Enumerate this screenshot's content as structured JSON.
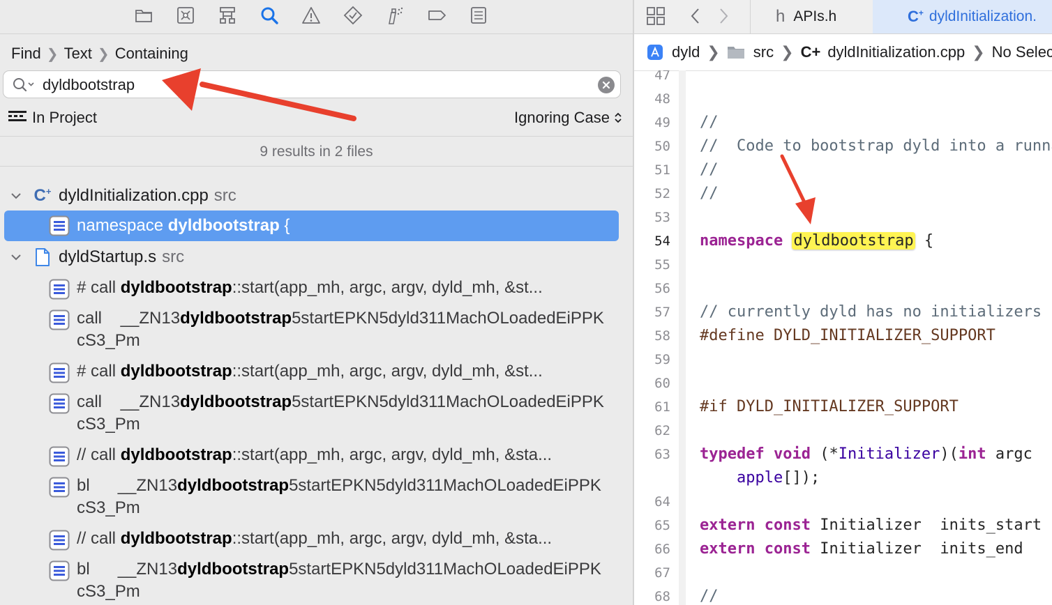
{
  "navigator": {
    "toolbar_icons": [
      "folder-icon",
      "source-control-icon",
      "hierarchy-icon",
      "find-icon",
      "issue-icon",
      "test-icon",
      "debug-icon",
      "breakpoint-icon",
      "report-icon"
    ],
    "breadcrumb": [
      "Find",
      "Text",
      "Containing"
    ],
    "search": {
      "value": "dyldbootstrap"
    },
    "scope": "In Project",
    "case_mode": "Ignoring Case",
    "summary": "9 results in 2 files",
    "files": [
      {
        "name": "dyldInitialization.cpp",
        "dir": "src",
        "results": [
          {
            "pre": "namespace ",
            "match": "dyldbootstrap",
            "post": " {",
            "selected": true
          }
        ]
      },
      {
        "name": "dyldStartup.s",
        "dir": "src",
        "results": [
          {
            "pre": "# call ",
            "match": "dyldbootstrap",
            "post": "::start(app_mh, argc, argv, dyld_mh, &st..."
          },
          {
            "pre": "call    __ZN13",
            "match": "dyldbootstrap",
            "post": "5startEPKN5dyld311MachOLoadedEiPPKcS3_Pm"
          },
          {
            "pre": "# call ",
            "match": "dyldbootstrap",
            "post": "::start(app_mh, argc, argv, dyld_mh, &st..."
          },
          {
            "pre": "call    __ZN13",
            "match": "dyldbootstrap",
            "post": "5startEPKN5dyld311MachOLoadedEiPPKcS3_Pm"
          },
          {
            "pre": "// call ",
            "match": "dyldbootstrap",
            "post": "::start(app_mh, argc, argv, dyld_mh, &sta..."
          },
          {
            "pre": "bl      __ZN13",
            "match": "dyldbootstrap",
            "post": "5startEPKN5dyld311MachOLoadedEiPPKcS3_Pm"
          },
          {
            "pre": "// call ",
            "match": "dyldbootstrap",
            "post": "::start(app_mh, argc, argv, dyld_mh, &sta..."
          },
          {
            "pre": "bl      __ZN13",
            "match": "dyldbootstrap",
            "post": "5startEPKN5dyld311MachOLoadedEiPPKcS3_Pm"
          }
        ]
      }
    ]
  },
  "editor": {
    "tabs": [
      {
        "icon": "h",
        "label": "APIs.h",
        "active": false
      },
      {
        "icon": "C+",
        "label": "dyldInitialization.",
        "active": true
      }
    ],
    "jump_bar": {
      "project": "dyld",
      "folder": "src",
      "file_icon": "C+",
      "file": "dyldInitialization.cpp",
      "selection": "No Selec"
    },
    "current_line": "54",
    "lines": [
      {
        "n": "47",
        "tokens": []
      },
      {
        "n": "48",
        "tokens": []
      },
      {
        "n": "49",
        "tokens": [
          {
            "t": "//",
            "c": "comment"
          }
        ]
      },
      {
        "n": "50",
        "tokens": [
          {
            "t": "//  Code to bootstrap dyld into a runnable state",
            "c": "comment"
          }
        ]
      },
      {
        "n": "51",
        "tokens": [
          {
            "t": "//",
            "c": "comment"
          }
        ]
      },
      {
        "n": "52",
        "tokens": [
          {
            "t": "//",
            "c": "comment"
          }
        ]
      },
      {
        "n": "53",
        "tokens": []
      },
      {
        "n": "54",
        "tokens": [
          {
            "t": "namespace",
            "c": "kw"
          },
          {
            "t": " "
          },
          {
            "t": "dyldbootstrap",
            "c": "hl"
          },
          {
            "t": " {"
          }
        ]
      },
      {
        "n": "55",
        "tokens": []
      },
      {
        "n": "56",
        "tokens": []
      },
      {
        "n": "57",
        "tokens": [
          {
            "t": "// currently dyld has no initializers",
            "c": "comment"
          }
        ]
      },
      {
        "n": "58",
        "tokens": [
          {
            "t": "#define DYLD_INITIALIZER_SUPPORT",
            "c": "pre"
          }
        ]
      },
      {
        "n": "59",
        "tokens": []
      },
      {
        "n": "60",
        "tokens": []
      },
      {
        "n": "61",
        "tokens": [
          {
            "t": "#if DYLD_INITIALIZER_SUPPORT",
            "c": "pre"
          }
        ]
      },
      {
        "n": "62",
        "tokens": []
      },
      {
        "n": "63",
        "tokens": [
          {
            "t": "typedef",
            "c": "kw"
          },
          {
            "t": " "
          },
          {
            "t": "void",
            "c": "kw"
          },
          {
            "t": " (*"
          },
          {
            "t": "Initializer",
            "c": "type2"
          },
          {
            "t": ")("
          },
          {
            "t": "int",
            "c": "kw"
          },
          {
            "t": " argc"
          }
        ]
      },
      {
        "n": "",
        "tokens": [
          {
            "t": "    "
          },
          {
            "t": "apple",
            "c": "type2"
          },
          {
            "t": "[]);"
          }
        ]
      },
      {
        "n": "64",
        "tokens": []
      },
      {
        "n": "65",
        "tokens": [
          {
            "t": "extern",
            "c": "kw"
          },
          {
            "t": " "
          },
          {
            "t": "const",
            "c": "kw"
          },
          {
            "t": " Initializer  inits_start"
          }
        ]
      },
      {
        "n": "66",
        "tokens": [
          {
            "t": "extern",
            "c": "kw"
          },
          {
            "t": " "
          },
          {
            "t": "const",
            "c": "kw"
          },
          {
            "t": " Initializer  inits_end"
          }
        ]
      },
      {
        "n": "67",
        "tokens": []
      },
      {
        "n": "68",
        "tokens": [
          {
            "t": "//",
            "c": "comment"
          }
        ]
      }
    ]
  },
  "colors": {
    "selection": "#5e9cf0",
    "annotation_arrow": "#e8402d",
    "match_highlight": "#fff453",
    "accent": "#2f6fdc"
  }
}
